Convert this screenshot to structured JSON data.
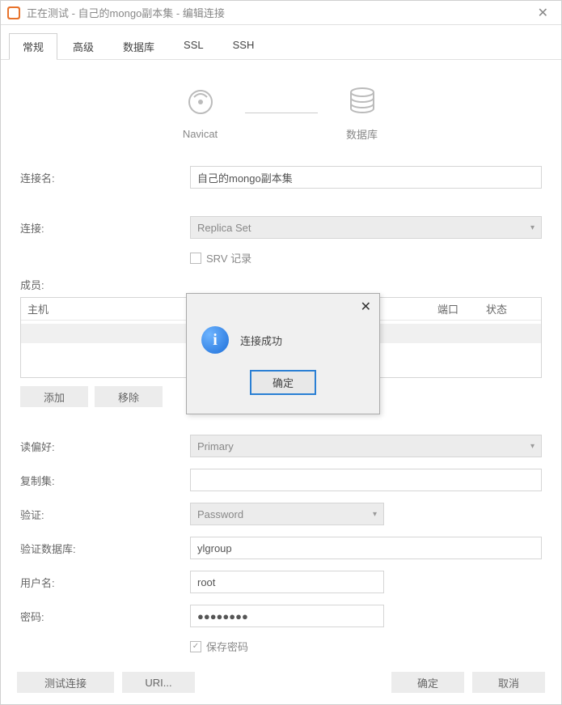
{
  "titlebar": {
    "title": "正在测试 - 自己的mongo副本集 - 编辑连接"
  },
  "tabs": [
    {
      "label": "常规",
      "active": true
    },
    {
      "label": "高级"
    },
    {
      "label": "数据库"
    },
    {
      "label": "SSL"
    },
    {
      "label": "SSH"
    }
  ],
  "header": {
    "left": "Navicat",
    "right": "数据库"
  },
  "labels": {
    "conn_name": "连接名:",
    "conn": "连接:",
    "srv": "SRV 记录",
    "members": "成员:",
    "host": "主机",
    "port": "端口",
    "status": "状态",
    "add": "添加",
    "remove": "移除",
    "read_pref": "读偏好:",
    "replica_set": "复制集:",
    "auth": "验证:",
    "auth_db": "验证数据库:",
    "username": "用户名:",
    "password": "密码:",
    "save_pwd": "保存密码"
  },
  "values": {
    "conn_name": "自己的mongo副本集",
    "conn_type": "Replica Set",
    "read_pref": "Primary",
    "auth": "Password",
    "auth_db": "ylgroup",
    "username": "root",
    "password": "●●●●●●●●"
  },
  "footer": {
    "test": "测试连接",
    "uri": "URI...",
    "ok": "确定",
    "cancel": "取消"
  },
  "dialog": {
    "message": "连接成功",
    "ok": "确定"
  }
}
